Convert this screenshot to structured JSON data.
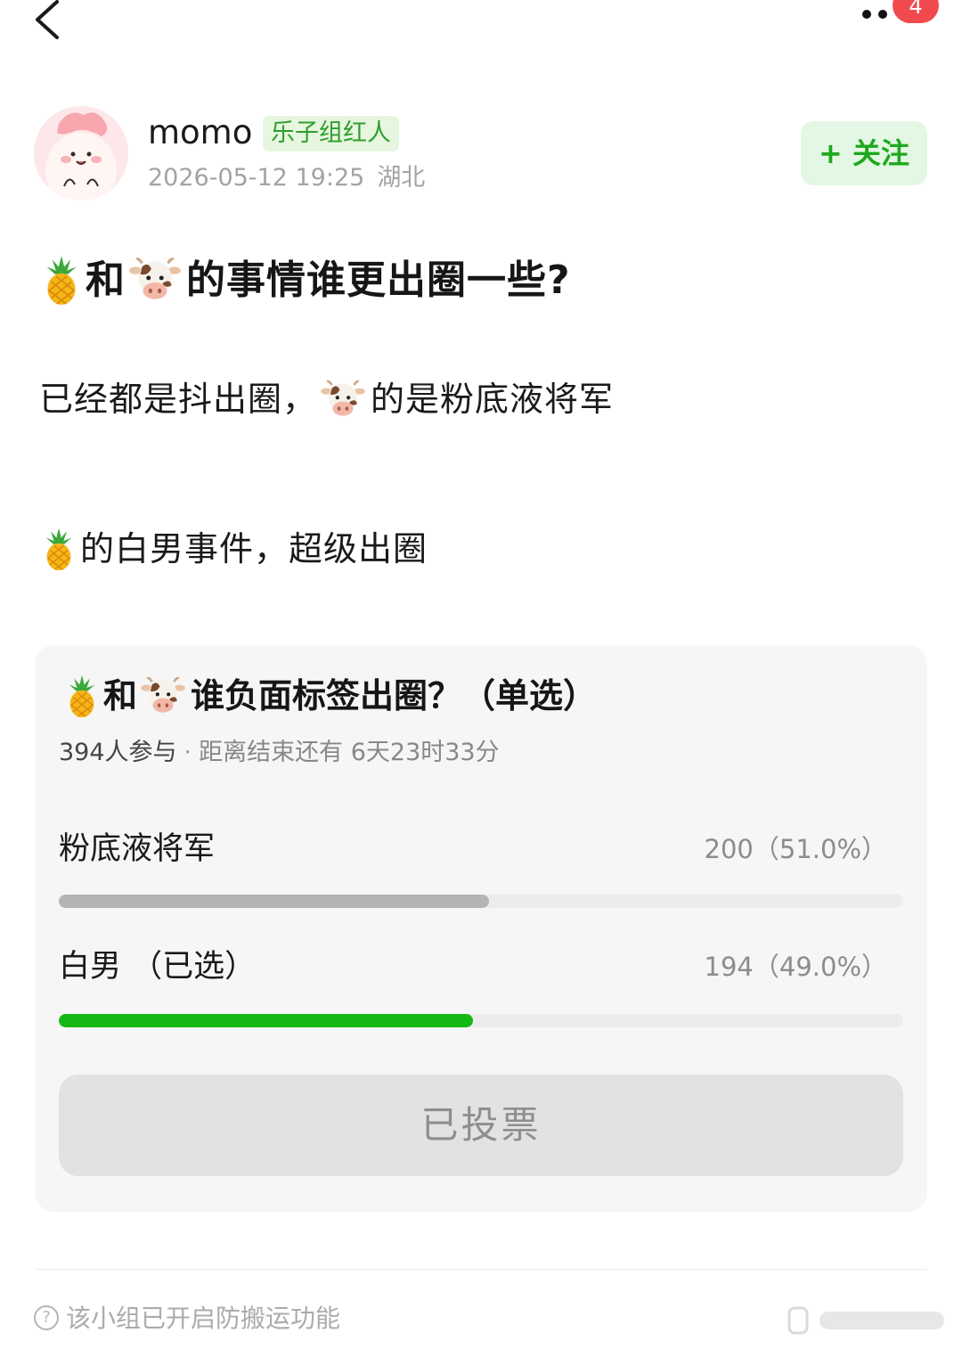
{
  "topbar": {
    "notification_count": "4"
  },
  "author": {
    "name": "momo",
    "tag": "乐子组红人",
    "datetime": "2026-05-12 19:25",
    "location": "湖北",
    "follow_label": "+ 关注"
  },
  "post": {
    "title_connector": "和",
    "title_rest": "的事情谁更出圈一些?",
    "line1_prefix": "已经都是抖出圈，",
    "line1_suffix": "的是粉底液将军",
    "line2_suffix": "的白男事件，超级出圈"
  },
  "poll": {
    "title_connector": "和",
    "title_rest": "谁负面标签出圈？（单选）",
    "participants": "394人参与",
    "separator": "·",
    "time_left": "距离结束还有 6天23时33分",
    "options": [
      {
        "label": "粉底液将军",
        "result": "200（51.0%）",
        "votes": 200,
        "percent": 51.0,
        "selected": false,
        "bar_color": "#b4b4b4"
      },
      {
        "label": "白男 （已选）",
        "result": "194（49.0%）",
        "votes": 194,
        "percent": 49.0,
        "selected": true,
        "bar_color": "#14b814"
      }
    ],
    "vote_button_label": "已投票"
  },
  "footer": {
    "note": "该小组已开启防搬运功能"
  },
  "icons": {
    "back": "chevron-left-icon",
    "more": "more-dots-icon",
    "pineapple": "pineapple-emoji-icon",
    "cow": "cow-emoji-icon",
    "help": "question-circle-icon"
  },
  "colors": {
    "accent_green": "#14b814",
    "tag_bg": "#e7f6df",
    "badge_red": "#f04a4f"
  }
}
